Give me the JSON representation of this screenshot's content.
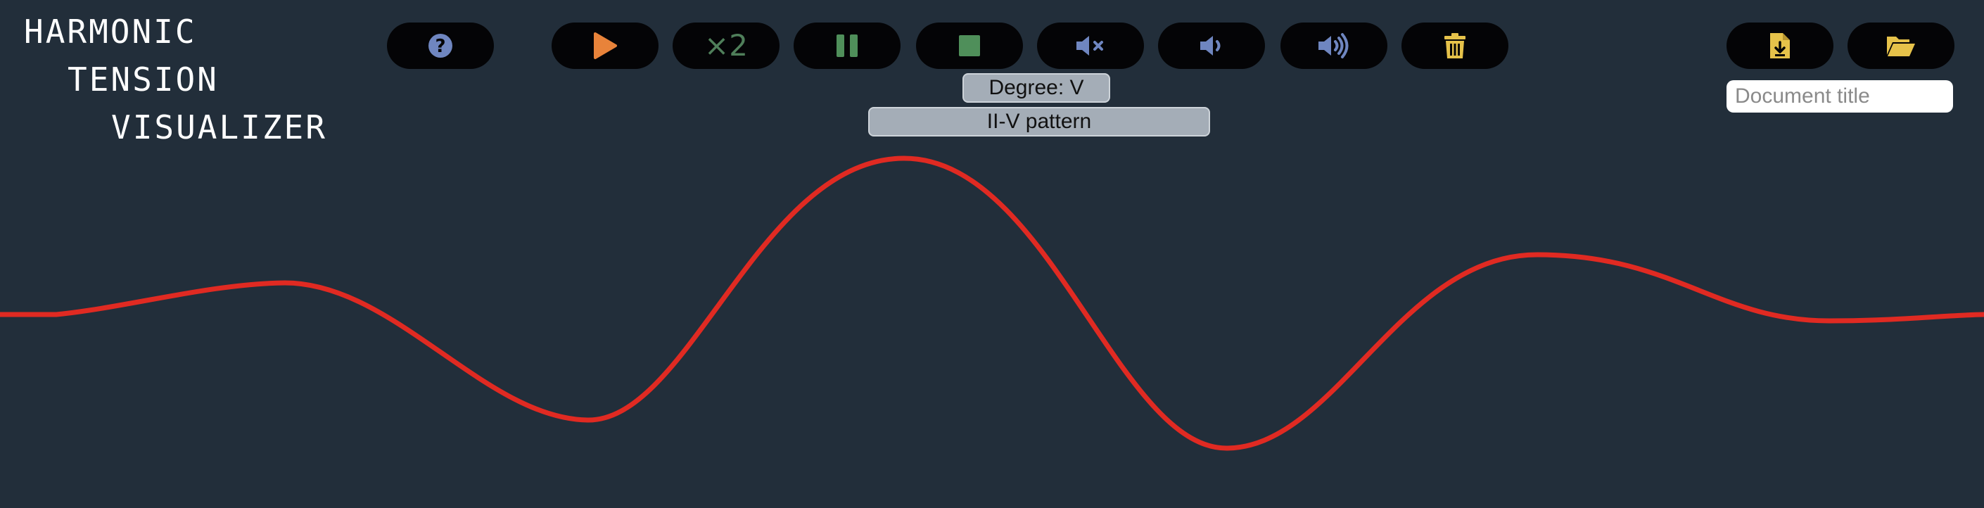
{
  "app": {
    "title_lines": [
      "HARMONIC",
      "TENSION",
      "VISUALIZER"
    ]
  },
  "toolbar": {
    "buttons": [
      {
        "name": "help",
        "icon": "question-circle-icon",
        "color": "#6f86c0"
      },
      {
        "name": "play",
        "icon": "play-icon",
        "color": "#e8833a"
      },
      {
        "name": "double-speed",
        "label": "×2",
        "color": "#4f7f5a"
      },
      {
        "name": "pause",
        "icon": "pause-icon",
        "color": "#4f8f5a"
      },
      {
        "name": "stop",
        "icon": "stop-icon",
        "color": "#4f8f5a"
      },
      {
        "name": "mute",
        "icon": "volume-mute-icon",
        "color": "#6f86c0"
      },
      {
        "name": "volume-down",
        "icon": "volume-low-icon",
        "color": "#6f86c0"
      },
      {
        "name": "volume-up",
        "icon": "volume-high-icon",
        "color": "#6f86c0"
      },
      {
        "name": "delete",
        "icon": "trash-icon",
        "color": "#e6c24a"
      },
      {
        "name": "save-file",
        "icon": "file-download-icon",
        "color": "#e6c24a"
      },
      {
        "name": "open-folder",
        "icon": "folder-open-icon",
        "color": "#e6c24a"
      }
    ]
  },
  "status": {
    "degree": "Degree: V",
    "pattern": "II-V pattern"
  },
  "document": {
    "title_value": "",
    "title_placeholder": "Document title"
  },
  "wave": {
    "color": "#e02a22",
    "background": "#222e3a"
  }
}
